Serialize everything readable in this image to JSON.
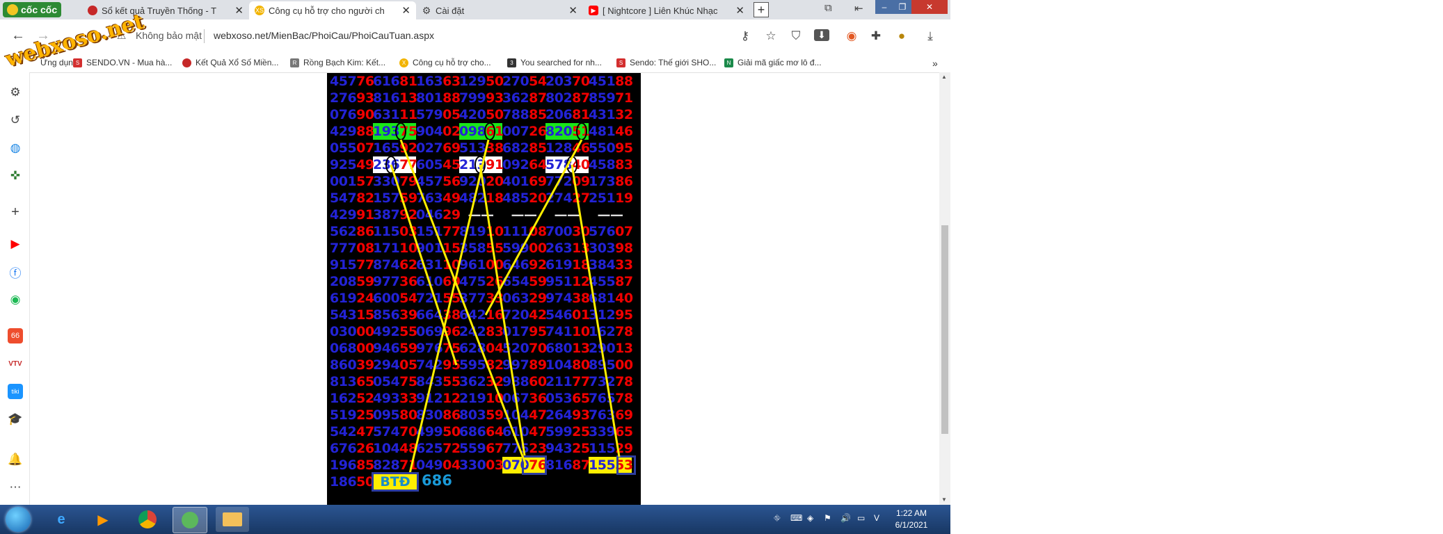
{
  "browser": {
    "brand": "cốc cốc",
    "tabs": [
      {
        "label": "Sổ kết quả Truyền Thống - T"
      },
      {
        "label": "Công cụ hỗ trợ cho người ch"
      },
      {
        "label": "Cài đặt"
      },
      {
        "label": "[ Nightcore ] Liên Khúc Nhạc"
      }
    ],
    "security_label": "Không bảo mật",
    "url": "webxoso.net/MienBac/PhoiCau/PhoiCauTuan.aspx",
    "bookmarks": [
      "Ứng dụng",
      "SENDO.VN - Mua hà...",
      "Kết Quả Xổ Số Miền...",
      "Rồng Bạch Kim: Kết...",
      "Công cụ hỗ trợ cho...",
      "You searched for nh...",
      "Sendo: Thế giới SHO...",
      "Giải mã giấc mơ lô đ..."
    ],
    "bookmark_overflow": "»"
  },
  "watermark": "webxoso.net",
  "grid": {
    "rows": [
      [
        "45776",
        "61681",
        "16363",
        "12950",
        "27054",
        "20370",
        "45188"
      ],
      [
        "27693",
        "81613",
        "80188",
        "79993",
        "36287",
        "80287",
        "85971"
      ],
      [
        "07690",
        "63111",
        "57905",
        "42050",
        "78885",
        "20681",
        "43132"
      ],
      [
        "42988",
        "19375",
        "90402",
        "09861",
        "00726",
        "82051",
        "48146"
      ],
      [
        "05507",
        "16592",
        "02769",
        "51338",
        "68285",
        "12846",
        "55095"
      ],
      [
        "92549",
        "23677",
        "60545",
        "21391",
        "09264",
        "57840",
        "45883"
      ],
      [
        "00157",
        "33079",
        "45756",
        "92020",
        "40169",
        "77209",
        "17386"
      ],
      [
        "54782",
        "15759",
        "76349",
        "48218",
        "48520",
        "27427",
        "25119"
      ],
      [
        "42991",
        "38792",
        "04629",
        "——",
        "——",
        "——",
        "——"
      ],
      [
        "56286",
        "11503",
        "15177",
        "81910",
        "11108",
        "70030",
        "57607"
      ],
      [
        "77708",
        "17110",
        "90115",
        "35855",
        "59900",
        "26313",
        "30398"
      ],
      [
        "91577",
        "87462",
        "63110",
        "96100",
        "64692",
        "61918",
        "38433"
      ],
      [
        "20859",
        "97736",
        "61069",
        "47526",
        "65459",
        "95112",
        "45587"
      ],
      [
        "61924",
        "60054",
        "72155",
        "37733",
        "06329",
        "97438",
        "68140"
      ],
      [
        "54315",
        "85639",
        "66438",
        "64216",
        "72042",
        "54601",
        "31295"
      ],
      [
        "03000",
        "49255",
        "06996",
        "24283",
        "01795",
        "74110",
        "16278"
      ],
      [
        "06800",
        "94659",
        "97675",
        "62804",
        "52070",
        "68013",
        "29013"
      ],
      [
        "86039",
        "29405",
        "74295",
        "59582",
        "99789",
        "10480",
        "89500"
      ],
      [
        "81365",
        "05475",
        "84355",
        "36232",
        "98860",
        "21177",
        "73278"
      ],
      [
        "16252",
        "49333",
        "91212",
        "21910",
        "06736",
        "05365",
        "76578"
      ],
      [
        "51925",
        "09580",
        "83086",
        "80359",
        "10447",
        "26493",
        "76369"
      ],
      [
        "54247",
        "57470",
        "49950",
        "68664",
        "61047",
        "59925",
        "33965"
      ],
      [
        "67626",
        "10448",
        "62572",
        "55967",
        "77523",
        "94325",
        "11529"
      ],
      [
        "19685",
        "82871",
        "04904",
        "33003",
        "07076",
        "81687",
        "15553"
      ],
      [
        "18650"
      ]
    ],
    "summary_label": "BTĐ",
    "summary_value": "686"
  },
  "taskbar": {
    "time": "1:22 AM",
    "date": "6/1/2021",
    "apps": [
      "ie-icon",
      "media-player-icon",
      "chrome-icon",
      "coccoc-icon",
      "explorer-icon"
    ]
  },
  "colors": {
    "blue_digits": "#2323d6",
    "red_digits": "#f00000",
    "highlight_green": "#19e619",
    "highlight_yellow": "#ffee00",
    "pattern_lines": "#ffee00"
  }
}
